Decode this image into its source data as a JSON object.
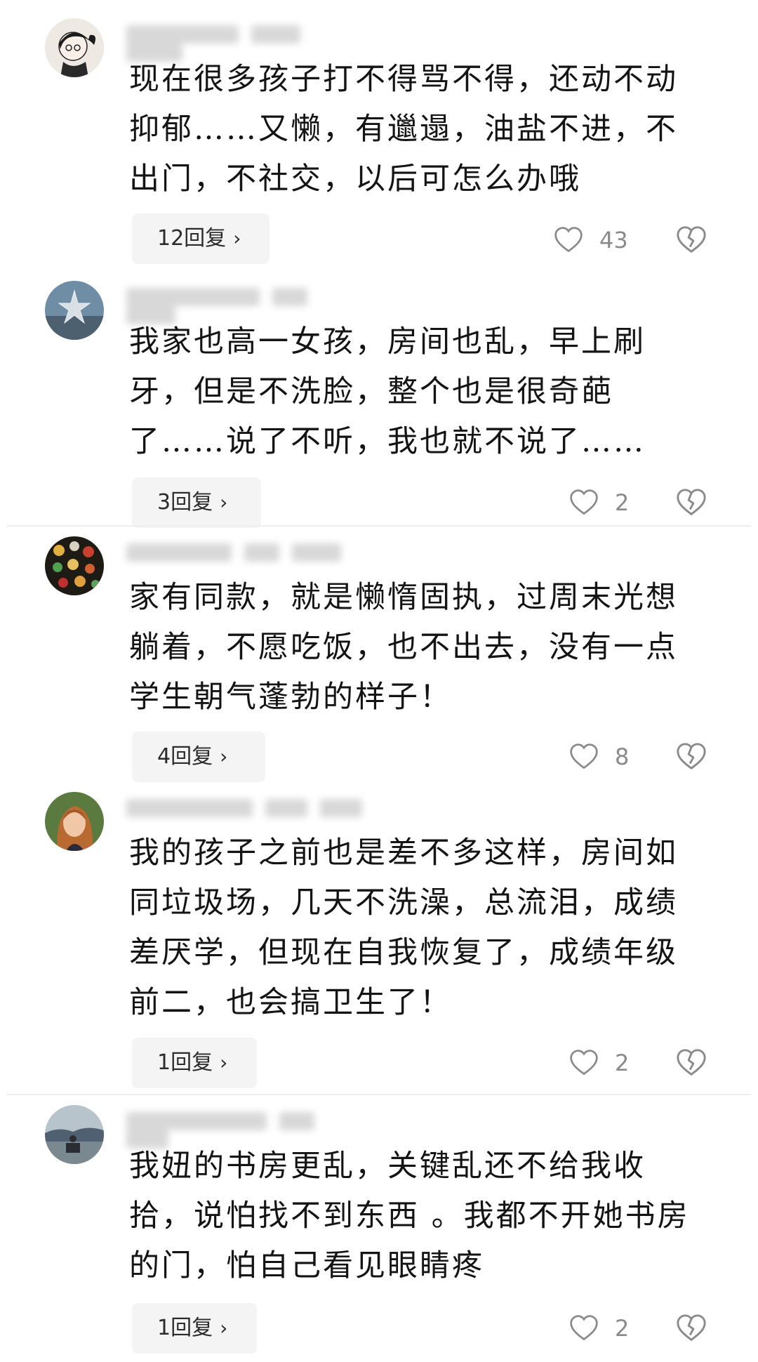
{
  "comments": [
    {
      "text": "现在很多孩子打不得骂不得，还动不动\n抑郁……又懒，有邋遢，油盐不进，不\n出门，不社交，以后可怎么办哦",
      "reply_label": "12回复",
      "likes": "43"
    },
    {
      "text": "我家也高一女孩，房间也乱，早上刷\n牙，但是不洗脸，整个也是很奇葩\n了……说了不听，我也就不说了……",
      "reply_label": "3回复",
      "likes": "2"
    },
    {
      "text": "家有同款，就是懒惰固执，过周末光想\n躺着，不愿吃饭，也不出去，没有一点\n学生朝气蓬勃的样子！",
      "reply_label": "4回复",
      "likes": "8"
    },
    {
      "text": "我的孩子之前也是差不多这样，房间如\n同垃圾场，几天不洗澡，总流泪，成绩\n差厌学，但现在自我恢复了，成绩年级\n前二，也会搞卫生了！",
      "reply_label": "1回复",
      "likes": "2"
    },
    {
      "text": "我妞的书房更乱，关键乱还不给我收\n拾，说怕找不到东西 。我都不开她书房\n的门，怕自己看见眼睛疼",
      "reply_label": "1回复",
      "likes": "2"
    }
  ],
  "icons": {
    "like": "heart-outline-icon",
    "dislike": "broken-heart-icon",
    "reply_arrow": "chevron-right-icon"
  },
  "colors": {
    "reply_bg": "#f4f4f4",
    "icon_gray": "#8a8a8a",
    "divider": "#eeeeee"
  }
}
